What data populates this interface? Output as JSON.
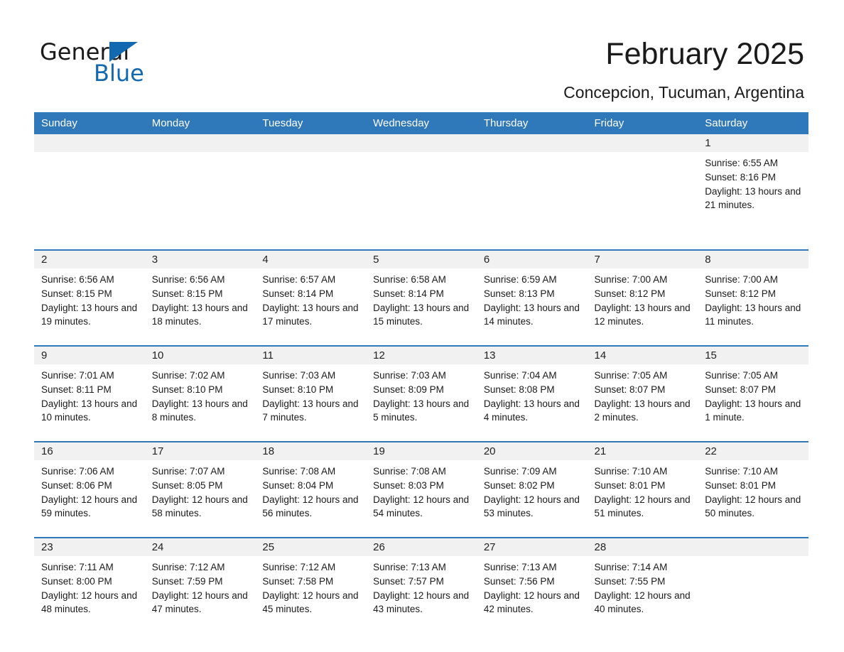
{
  "brand": {
    "name_part1": "General",
    "name_part2": "Blue",
    "accent_color": "#1269b0"
  },
  "header": {
    "title": "February 2025",
    "location": "Concepcion, Tucuman, Argentina",
    "header_bg": "#2f78ba",
    "daynum_bg": "#f1f1f1"
  },
  "weekdays": [
    "Sunday",
    "Monday",
    "Tuesday",
    "Wednesday",
    "Thursday",
    "Friday",
    "Saturday"
  ],
  "weeks": [
    [
      {
        "day": "",
        "sunrise": "",
        "sunset": "",
        "daylight": ""
      },
      {
        "day": "",
        "sunrise": "",
        "sunset": "",
        "daylight": ""
      },
      {
        "day": "",
        "sunrise": "",
        "sunset": "",
        "daylight": ""
      },
      {
        "day": "",
        "sunrise": "",
        "sunset": "",
        "daylight": ""
      },
      {
        "day": "",
        "sunrise": "",
        "sunset": "",
        "daylight": ""
      },
      {
        "day": "",
        "sunrise": "",
        "sunset": "",
        "daylight": ""
      },
      {
        "day": "1",
        "sunrise": "Sunrise: 6:55 AM",
        "sunset": "Sunset: 8:16 PM",
        "daylight": "Daylight: 13 hours and 21 minutes."
      }
    ],
    [
      {
        "day": "2",
        "sunrise": "Sunrise: 6:56 AM",
        "sunset": "Sunset: 8:15 PM",
        "daylight": "Daylight: 13 hours and 19 minutes."
      },
      {
        "day": "3",
        "sunrise": "Sunrise: 6:56 AM",
        "sunset": "Sunset: 8:15 PM",
        "daylight": "Daylight: 13 hours and 18 minutes."
      },
      {
        "day": "4",
        "sunrise": "Sunrise: 6:57 AM",
        "sunset": "Sunset: 8:14 PM",
        "daylight": "Daylight: 13 hours and 17 minutes."
      },
      {
        "day": "5",
        "sunrise": "Sunrise: 6:58 AM",
        "sunset": "Sunset: 8:14 PM",
        "daylight": "Daylight: 13 hours and 15 minutes."
      },
      {
        "day": "6",
        "sunrise": "Sunrise: 6:59 AM",
        "sunset": "Sunset: 8:13 PM",
        "daylight": "Daylight: 13 hours and 14 minutes."
      },
      {
        "day": "7",
        "sunrise": "Sunrise: 7:00 AM",
        "sunset": "Sunset: 8:12 PM",
        "daylight": "Daylight: 13 hours and 12 minutes."
      },
      {
        "day": "8",
        "sunrise": "Sunrise: 7:00 AM",
        "sunset": "Sunset: 8:12 PM",
        "daylight": "Daylight: 13 hours and 11 minutes."
      }
    ],
    [
      {
        "day": "9",
        "sunrise": "Sunrise: 7:01 AM",
        "sunset": "Sunset: 8:11 PM",
        "daylight": "Daylight: 13 hours and 10 minutes."
      },
      {
        "day": "10",
        "sunrise": "Sunrise: 7:02 AM",
        "sunset": "Sunset: 8:10 PM",
        "daylight": "Daylight: 13 hours and 8 minutes."
      },
      {
        "day": "11",
        "sunrise": "Sunrise: 7:03 AM",
        "sunset": "Sunset: 8:10 PM",
        "daylight": "Daylight: 13 hours and 7 minutes."
      },
      {
        "day": "12",
        "sunrise": "Sunrise: 7:03 AM",
        "sunset": "Sunset: 8:09 PM",
        "daylight": "Daylight: 13 hours and 5 minutes."
      },
      {
        "day": "13",
        "sunrise": "Sunrise: 7:04 AM",
        "sunset": "Sunset: 8:08 PM",
        "daylight": "Daylight: 13 hours and 4 minutes."
      },
      {
        "day": "14",
        "sunrise": "Sunrise: 7:05 AM",
        "sunset": "Sunset: 8:07 PM",
        "daylight": "Daylight: 13 hours and 2 minutes."
      },
      {
        "day": "15",
        "sunrise": "Sunrise: 7:05 AM",
        "sunset": "Sunset: 8:07 PM",
        "daylight": "Daylight: 13 hours and 1 minute."
      }
    ],
    [
      {
        "day": "16",
        "sunrise": "Sunrise: 7:06 AM",
        "sunset": "Sunset: 8:06 PM",
        "daylight": "Daylight: 12 hours and 59 minutes."
      },
      {
        "day": "17",
        "sunrise": "Sunrise: 7:07 AM",
        "sunset": "Sunset: 8:05 PM",
        "daylight": "Daylight: 12 hours and 58 minutes."
      },
      {
        "day": "18",
        "sunrise": "Sunrise: 7:08 AM",
        "sunset": "Sunset: 8:04 PM",
        "daylight": "Daylight: 12 hours and 56 minutes."
      },
      {
        "day": "19",
        "sunrise": "Sunrise: 7:08 AM",
        "sunset": "Sunset: 8:03 PM",
        "daylight": "Daylight: 12 hours and 54 minutes."
      },
      {
        "day": "20",
        "sunrise": "Sunrise: 7:09 AM",
        "sunset": "Sunset: 8:02 PM",
        "daylight": "Daylight: 12 hours and 53 minutes."
      },
      {
        "day": "21",
        "sunrise": "Sunrise: 7:10 AM",
        "sunset": "Sunset: 8:01 PM",
        "daylight": "Daylight: 12 hours and 51 minutes."
      },
      {
        "day": "22",
        "sunrise": "Sunrise: 7:10 AM",
        "sunset": "Sunset: 8:01 PM",
        "daylight": "Daylight: 12 hours and 50 minutes."
      }
    ],
    [
      {
        "day": "23",
        "sunrise": "Sunrise: 7:11 AM",
        "sunset": "Sunset: 8:00 PM",
        "daylight": "Daylight: 12 hours and 48 minutes."
      },
      {
        "day": "24",
        "sunrise": "Sunrise: 7:12 AM",
        "sunset": "Sunset: 7:59 PM",
        "daylight": "Daylight: 12 hours and 47 minutes."
      },
      {
        "day": "25",
        "sunrise": "Sunrise: 7:12 AM",
        "sunset": "Sunset: 7:58 PM",
        "daylight": "Daylight: 12 hours and 45 minutes."
      },
      {
        "day": "26",
        "sunrise": "Sunrise: 7:13 AM",
        "sunset": "Sunset: 7:57 PM",
        "daylight": "Daylight: 12 hours and 43 minutes."
      },
      {
        "day": "27",
        "sunrise": "Sunrise: 7:13 AM",
        "sunset": "Sunset: 7:56 PM",
        "daylight": "Daylight: 12 hours and 42 minutes."
      },
      {
        "day": "28",
        "sunrise": "Sunrise: 7:14 AM",
        "sunset": "Sunset: 7:55 PM",
        "daylight": "Daylight: 12 hours and 40 minutes."
      },
      {
        "day": "",
        "sunrise": "",
        "sunset": "",
        "daylight": ""
      }
    ]
  ]
}
